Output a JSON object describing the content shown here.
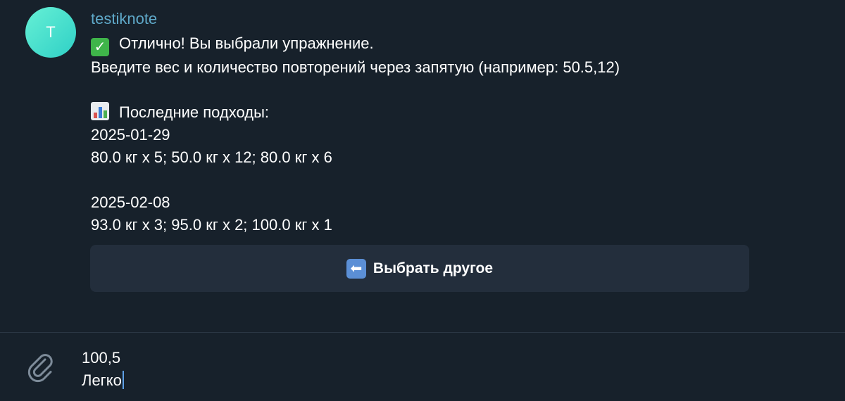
{
  "chat": {
    "avatar_letter": "T",
    "sender": "testiknote",
    "message": {
      "line1": "Отлично! Вы выбрали упражнение.",
      "line2": "Введите вес и количество повторений через запятую (например: 50.5,12)",
      "history_header": "Последние подходы:",
      "date1": "2025-01-29",
      "sets1": "80.0 кг x 5; 50.0 кг x 12; 80.0 кг x 6",
      "date2": "2025-02-08",
      "sets2": "93.0 кг x 3; 95.0 кг x 2; 100.0 кг x 1"
    },
    "inline_button": {
      "label": "Выбрать другое",
      "icon": "left-arrow-icon"
    }
  },
  "composer": {
    "line1": "100,5",
    "line2": "Легко",
    "attach_icon": "paperclip-icon"
  },
  "colors": {
    "background": "#17212b",
    "sender_name": "#5fa9c9",
    "button_bg": "#232e3c",
    "caret": "#5ea0e6"
  }
}
